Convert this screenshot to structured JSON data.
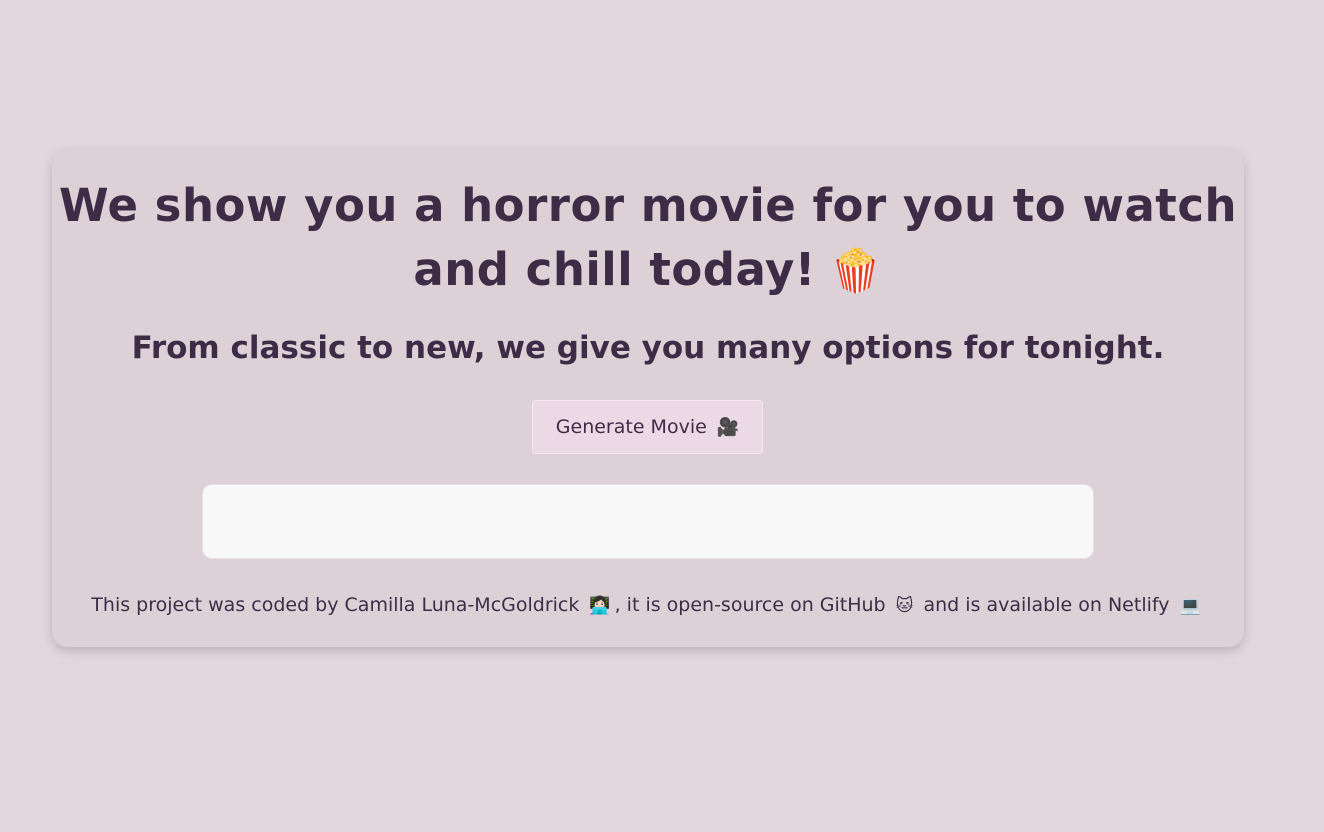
{
  "header": {
    "title_text": "We show you a horror movie for you to watch and chill today!",
    "title_emoji": "🍿",
    "subtitle": "From classic to new, we give you many options for tonight."
  },
  "generate_button": {
    "label": "Generate Movie",
    "icon": "🎥"
  },
  "result": {
    "text": ""
  },
  "footer": {
    "part1": "This project was coded by Camilla Luna-McGoldrick",
    "emoji1": "👩🏻‍💻",
    "part2": ", it is open-source on GitHub",
    "emoji2": "🐱",
    "part3": "and is available on Netlify",
    "emoji3": "💻"
  },
  "colors": {
    "background": "#e2d7de",
    "card": "#ddd1d7",
    "text": "#3e2c47",
    "button": "#ecd9e6",
    "result_box": "#f8f8f8"
  }
}
